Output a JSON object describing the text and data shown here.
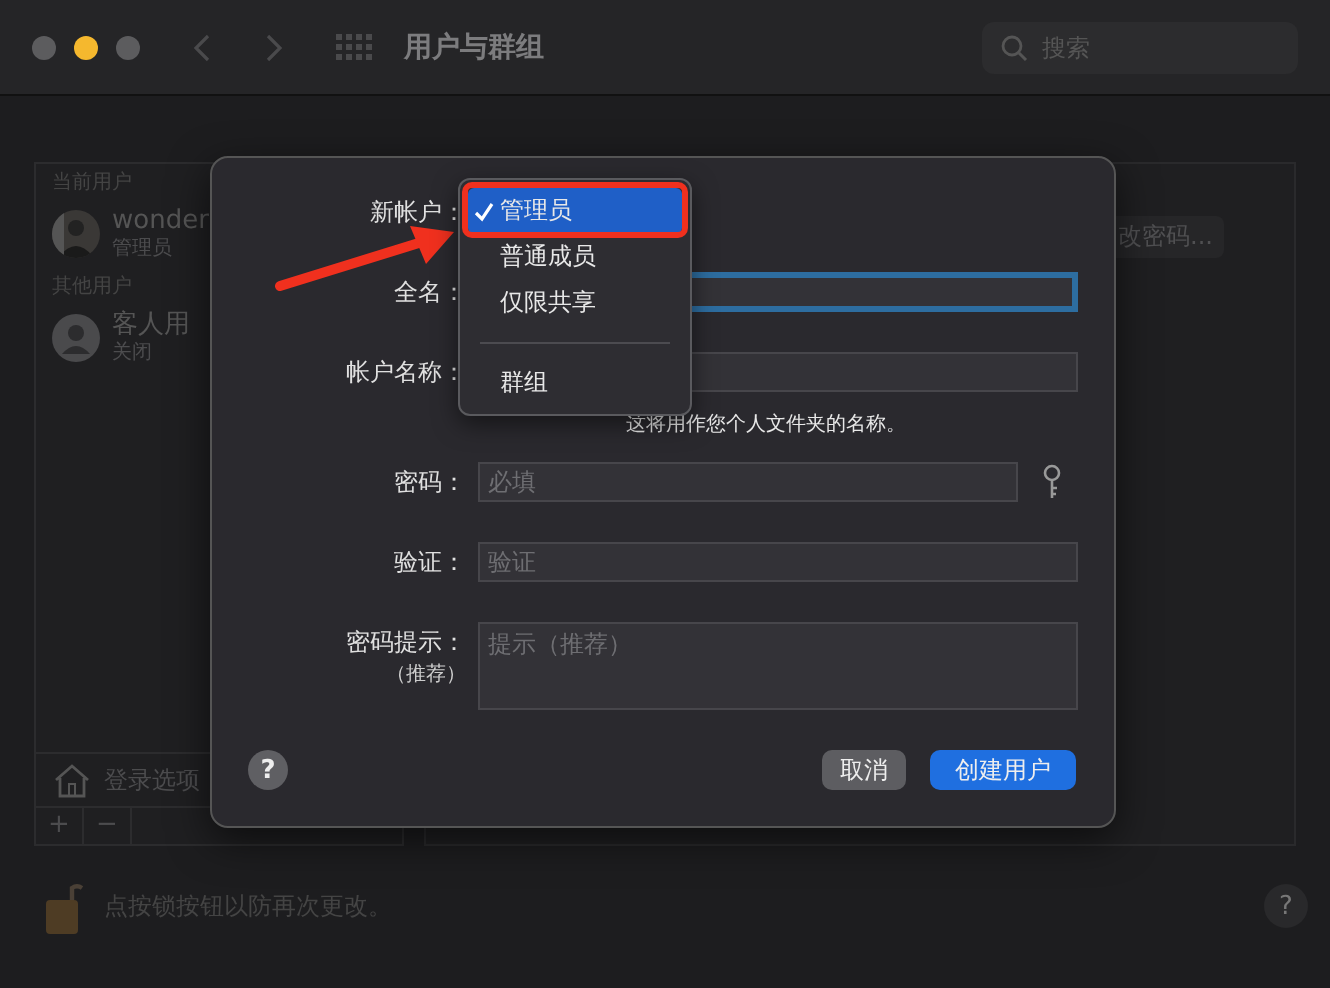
{
  "window": {
    "title": "用户与群组",
    "controls": [
      {
        "color": "#5c5c5e"
      },
      {
        "color": "#f5b82e"
      },
      {
        "color": "#5c5c5e"
      }
    ],
    "search": {
      "placeholder": "搜索"
    }
  },
  "sidebar": {
    "sections": [
      {
        "heading": "当前用户",
        "users": [
          {
            "name": "wonder",
            "role": "管理员"
          }
        ]
      },
      {
        "heading": "其他用户",
        "users": [
          {
            "name": "客人用",
            "role": "关闭",
            "kind": "guest"
          }
        ]
      }
    ],
    "login_options": "登录选项",
    "add": "+",
    "remove": "−"
  },
  "detail": {
    "change_password": "改密码..."
  },
  "lock_text": "点按锁按钮以防再次更改。",
  "help": "?",
  "dialog": {
    "rows": [
      {
        "kind": "popup",
        "label": "新帐户："
      },
      {
        "kind": "text",
        "label": "全名：",
        "focused": true
      },
      {
        "kind": "text",
        "label": "帐户名称：",
        "focused": false,
        "hint": "这将用作您个人文件夹的名称。"
      },
      {
        "kind": "password",
        "label": "密码：",
        "placeholder": "必填"
      },
      {
        "kind": "text",
        "label": "验证：",
        "placeholder": "验证",
        "focused": false
      },
      {
        "kind": "textarea",
        "label": "密码提示：",
        "sublabel": "（推荐）",
        "placeholder": "提示（推荐）"
      }
    ],
    "menu": [
      {
        "label": "管理员",
        "selected": true,
        "checked": true,
        "kind": "item"
      },
      {
        "label": "普通成员",
        "selected": false,
        "checked": false,
        "kind": "item"
      },
      {
        "label": "仅限共享",
        "selected": false,
        "checked": false,
        "kind": "item"
      },
      {
        "kind": "separator"
      },
      {
        "label": "群组",
        "selected": false,
        "checked": false,
        "kind": "item"
      }
    ],
    "help": "?",
    "buttons": [
      {
        "label": "取消",
        "kind": "secondary"
      },
      {
        "label": "创建用户",
        "kind": "primary"
      }
    ]
  }
}
